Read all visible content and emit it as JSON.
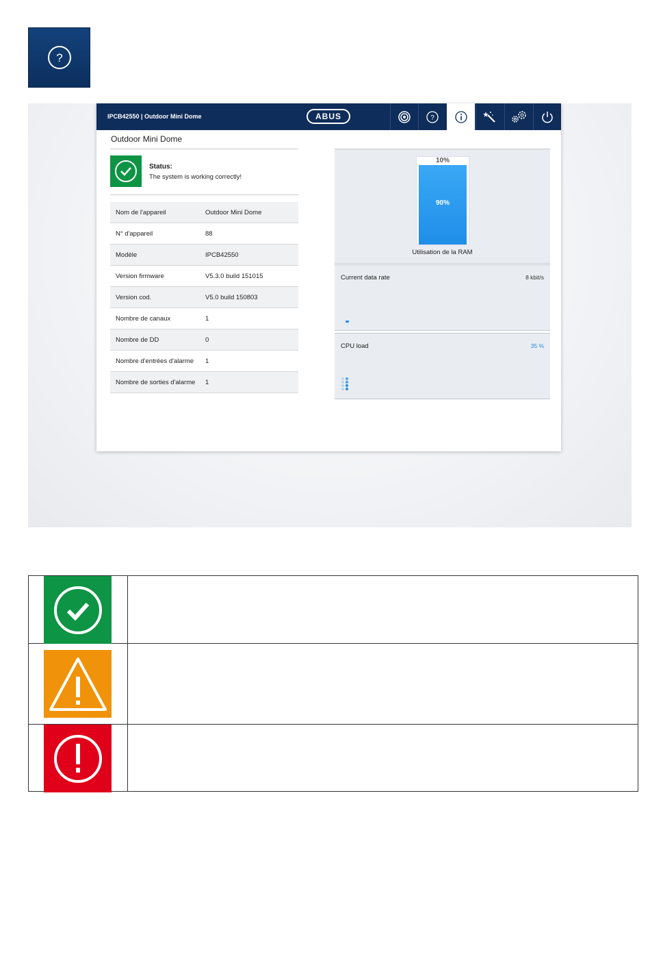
{
  "help_tile": {
    "icon": "help-icon"
  },
  "app": {
    "header": {
      "title": "IPCB42550  |  Outdoor Mini Dome",
      "logo": "ABUS",
      "nav_icons": [
        "live-view-icon",
        "help-icon",
        "info-icon",
        "wizard-icon",
        "settings-icon",
        "power-icon"
      ],
      "active_nav": "info-icon"
    },
    "page_title": "Outdoor Mini Dome",
    "status": {
      "label": "Status:",
      "text": "The system is working correctly!",
      "color": "#0d9444"
    },
    "device_info": [
      {
        "key": "Nom de l'appareil",
        "value": "Outdoor Mini Dome"
      },
      {
        "key": "N° d'appareil",
        "value": "88"
      },
      {
        "key": "Modèle",
        "value": "IPCB42550"
      },
      {
        "key": "Version firmware",
        "value": "V5.3.0 build 151015"
      },
      {
        "key": "Version cod.",
        "value": "V5.0 build 150803"
      },
      {
        "key": "Nombre de canaux",
        "value": "1"
      },
      {
        "key": "Nombre de DD",
        "value": "0"
      },
      {
        "key": "Nombre d'entrées d'alarme",
        "value": "1"
      },
      {
        "key": "Nombre de sorties d'alarme",
        "value": "1"
      }
    ],
    "ram": {
      "free_label": "10%",
      "used_label": "90%",
      "used_fraction": 0.9,
      "caption": "Utilisation de la RAM"
    },
    "data_rate": {
      "label": "Current data rate",
      "value": "8 kbit/s"
    },
    "cpu": {
      "label": "CPU load",
      "value": "35 %"
    }
  },
  "legend": [
    {
      "icon": "ok-check-icon",
      "color": "#0d9444"
    },
    {
      "icon": "warning-triangle-icon",
      "color": "#f0930a"
    },
    {
      "icon": "error-exclamation-icon",
      "color": "#e0001a"
    }
  ]
}
